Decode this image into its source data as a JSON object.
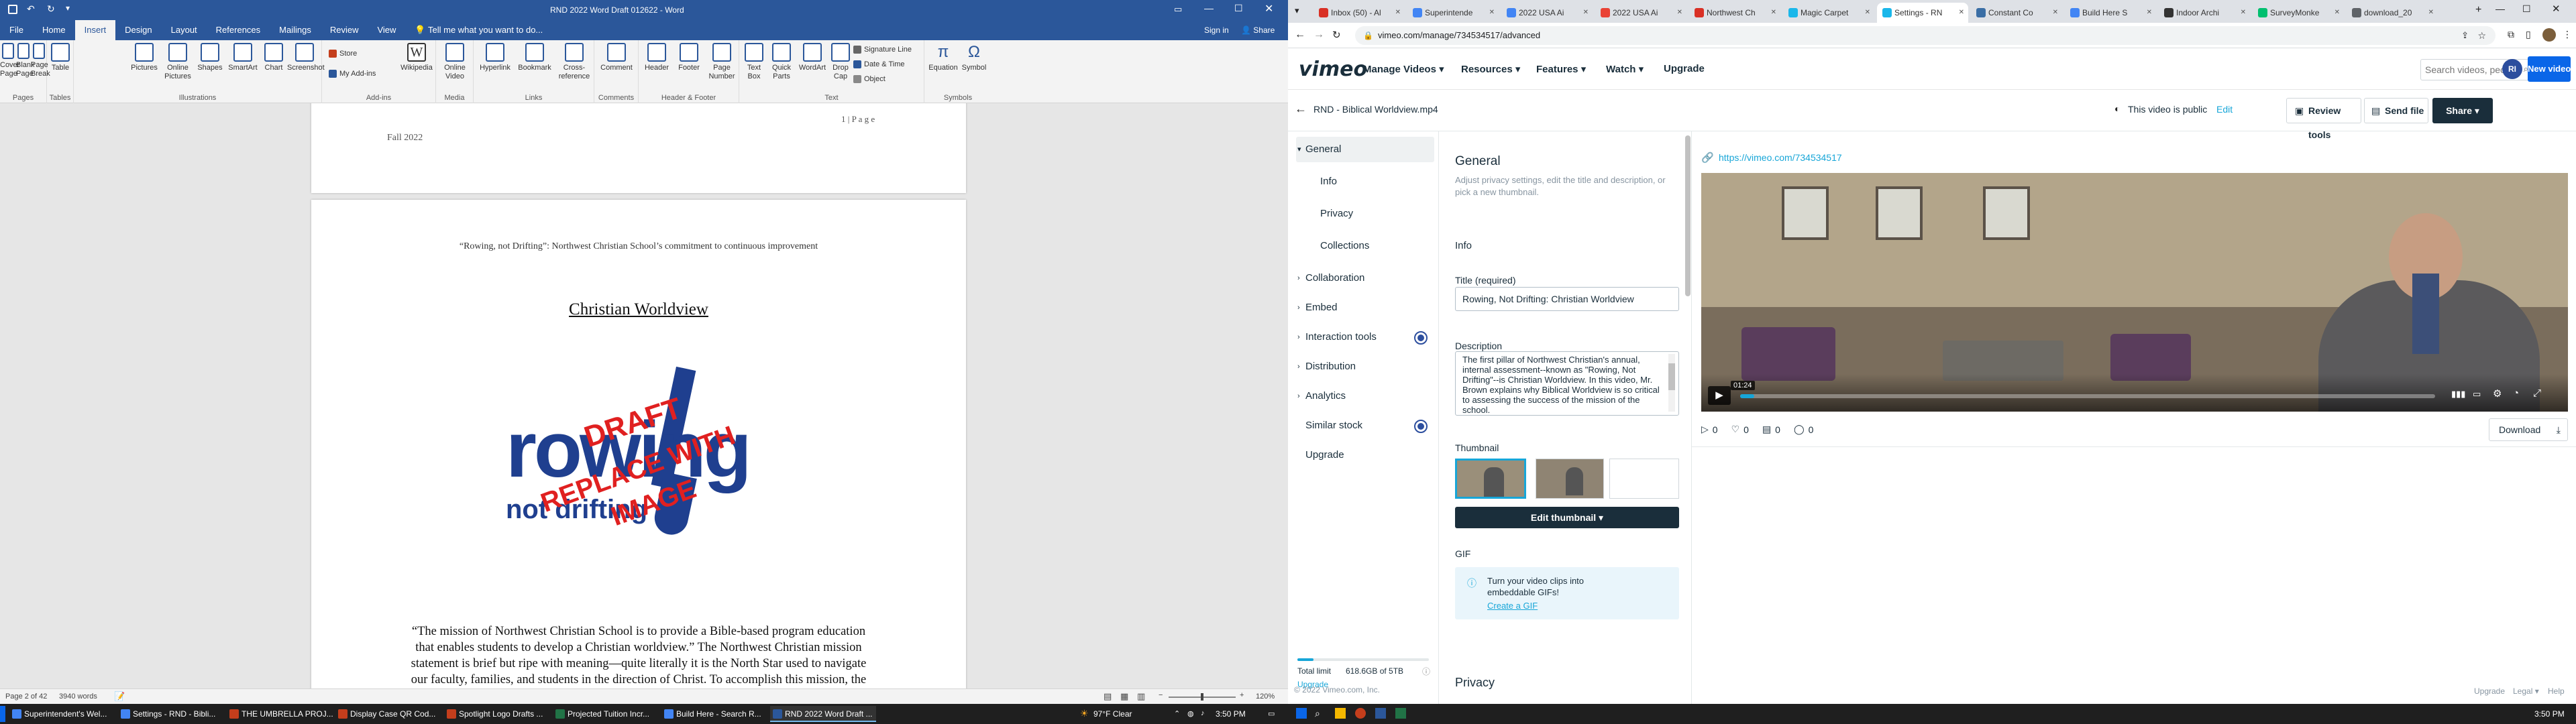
{
  "word": {
    "title": "RND 2022 Word Draft 012622 - Word",
    "sign_in": "Sign in",
    "share": "Share",
    "tabs": [
      "File",
      "Home",
      "Insert",
      "Design",
      "Layout",
      "References",
      "Mailings",
      "Review",
      "View"
    ],
    "tell_me": "Tell me what you want to do...",
    "ribbon": {
      "cover_page": "Cover Page",
      "blank_page": "Blank Page",
      "page_break": "Page Break",
      "group_pages": "Pages",
      "table": "Table",
      "group_tables": "Tables",
      "pictures": "Pictures",
      "online_pictures": "Online Pictures",
      "shapes": "Shapes",
      "smartart": "SmartArt",
      "chart": "Chart",
      "screenshot": "Screenshot",
      "group_illustrations": "Illustrations",
      "store": "Store",
      "my_addins": "My Add-ins",
      "wikipedia": "Wikipedia",
      "group_addins": "Add-ins",
      "online_video": "Online Video",
      "group_media": "Media",
      "hyperlink": "Hyperlink",
      "bookmark": "Bookmark",
      "cross_reference": "Cross-reference",
      "group_links": "Links",
      "comment": "Comment",
      "group_comments": "Comments",
      "header": "Header",
      "footer": "Footer",
      "page_number": "Page Number",
      "group_header_footer": "Header & Footer",
      "text_box": "Text Box",
      "quick_parts": "Quick Parts",
      "wordart": "WordArt",
      "drop_cap": "Drop Cap",
      "signature_line": "Signature Line",
      "date_time": "Date & Time",
      "object": "Object",
      "group_text": "Text",
      "equation": "Equation",
      "symbol": "Symbol",
      "group_symbols": "Symbols"
    },
    "page1_footer_left": "Fall 2022",
    "page1_footer_right": "1 | P a g e",
    "page2_header": "“Rowing, not Drifting”:  Northwest Christian School’s commitment to continuous improvement",
    "page2_heading": "Christian Worldview",
    "logo_rowing": "rowing",
    "logo_not": "not drifting",
    "logo_draft": "DRAFT",
    "logo_replace": "REPLACE WITH",
    "logo_image": "IMAGE",
    "body_lines": [
      "“The mission of Northwest Christian School is to provide a Bible-based program education",
      "that enables students to develop a Christian worldview.”  The Northwest Christian mission",
      "statement is brief but ripe with meaning—quite literally it is the North Star used to navigate",
      "our faculty, families, and students in the direction of Christ.  To accomplish this mission, the"
    ],
    "status_page": "Page 2 of 42",
    "status_words": "3940 words",
    "status_zoom": "120%"
  },
  "browser": {
    "tabs": [
      {
        "label": "Inbox (50) - Al",
        "color": "#d93025"
      },
      {
        "label": "Superintende",
        "color": "#4285f4"
      },
      {
        "label": "2022 USA Ai",
        "color": "#4285f4"
      },
      {
        "label": "2022 USA Ai",
        "color": "#e94235"
      },
      {
        "label": "Northwest Ch",
        "color": "#d93025"
      },
      {
        "label": "Magic Carpet",
        "color": "#1ab7ea"
      },
      {
        "label": "Settings - RN",
        "color": "#1ab7ea"
      },
      {
        "label": "Constant Co",
        "color": "#3a6ea5"
      },
      {
        "label": "Build Here S",
        "color": "#4285f4"
      },
      {
        "label": "Indoor Archi",
        "color": "#333333"
      },
      {
        "label": "SurveyMonke",
        "color": "#00bf6f"
      },
      {
        "label": "download_20",
        "color": "#5f6368"
      }
    ],
    "url": "vimeo.com/manage/734534517/advanced"
  },
  "vimeo": {
    "logo": "vimeo",
    "nav": [
      "Manage Videos",
      "Resources",
      "Features",
      "Watch",
      "Upgrade"
    ],
    "search_placeholder": "Search videos, people, and more",
    "avatar": "RI",
    "new_video": "New video",
    "file_name": "RND - Biblical Worldview.mp4",
    "public_text": "This video is public",
    "edit": "Edit",
    "review_tools": "Review tools",
    "send_file": "Send file",
    "share": "Share",
    "sidebar": {
      "general": "General",
      "info": "Info",
      "privacy": "Privacy",
      "collections": "Collections",
      "collaboration": "Collaboration",
      "embed": "Embed",
      "interaction_tools": "Interaction tools",
      "distribution": "Distribution",
      "analytics": "Analytics",
      "similar_stock": "Similar stock",
      "upgrade": "Upgrade",
      "total_limit_label": "Total limit",
      "total_limit_value": "618.6GB of 5TB",
      "upgrade_link": "Upgrade"
    },
    "panel": {
      "title": "General",
      "subtitle": "Adjust privacy settings, edit the title and description, or pick a new thumbnail.",
      "info_heading": "Info",
      "title_label": "Title (required)",
      "title_value": "Rowing, Not Drifting:  Christian Worldview",
      "description_label": "Description",
      "description_value": "The first pillar of Northwest Christian's annual, internal assessment--known as \"Rowing, Not Drifting\"--is Christian Worldview.  In this video, Mr. Brown explains why Biblical Worldview is so critical to assessing the success of the mission of the school.",
      "thumbnail_label": "Thumbnail",
      "edit_thumbnail": "Edit thumbnail",
      "gif_label": "GIF",
      "gif_text": "Turn your video clips into embeddable GIFs!",
      "create_gif": "Create a GIF",
      "privacy_heading": "Privacy",
      "copyright": "© 2022 Vimeo.com, Inc."
    },
    "player": {
      "link": "https://vimeo.com/734534517",
      "time": "01:24",
      "progress": 0.02,
      "plays": "0",
      "likes": "0",
      "collections": "0",
      "comments": "0",
      "download": "Download",
      "footer_upgrade": "Upgrade",
      "footer_legal": "Legal",
      "footer_help": "Help"
    }
  },
  "taskbar": {
    "items": [
      {
        "label": "Superintendent's Wel...",
        "color": "#4285f4"
      },
      {
        "label": "Settings - RND - Bibli...",
        "color": "#4285f4"
      },
      {
        "label": "THE UMBRELLA PROJ...",
        "color": "#c43e1c"
      },
      {
        "label": "Display Case QR Cod...",
        "color": "#c43e1c"
      },
      {
        "label": "Spotlight Logo Drafts ...",
        "color": "#c43e1c"
      },
      {
        "label": "Projected Tuition Incr...",
        "color": "#217346"
      },
      {
        "label": "Build Here - Search R...",
        "color": "#4285f4"
      },
      {
        "label": "RND 2022 Word Draft ...",
        "color": "#2b579a"
      }
    ],
    "weather": "97°F  Clear",
    "time1": "3:50 PM",
    "time2": "3:50 PM"
  }
}
